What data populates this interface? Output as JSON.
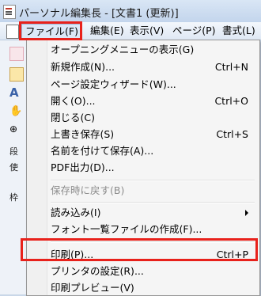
{
  "window": {
    "title": "パーソナル編集長 - [文書1 (更新)]"
  },
  "menubar": {
    "items": [
      {
        "label": "ファイル(F)"
      },
      {
        "label": "編集(E)"
      },
      {
        "label": "表示(V)"
      },
      {
        "label": "ページ(P)"
      },
      {
        "label": "書式(L)"
      }
    ]
  },
  "leftstrip": {
    "label1": "段",
    "label2": "使",
    "label3": "枠"
  },
  "file_menu": {
    "items": [
      {
        "label": "オープニングメニューの表示(G)",
        "shortcut": ""
      },
      {
        "label": "新規作成(N)...",
        "shortcut": "Ctrl+N"
      },
      {
        "label": "ページ設定ウィザード(W)...",
        "shortcut": ""
      },
      {
        "label": "開く(O)...",
        "shortcut": "Ctrl+O"
      },
      {
        "label": "閉じる(C)",
        "shortcut": ""
      },
      {
        "label": "上書き保存(S)",
        "shortcut": "Ctrl+S"
      },
      {
        "label": "名前を付けて保存(A)...",
        "shortcut": ""
      },
      {
        "label": "PDF出力(D)...",
        "shortcut": ""
      },
      {
        "label": "保存時に戻す(B)",
        "shortcut": ""
      },
      {
        "label": "読み込み(I)",
        "shortcut": ""
      },
      {
        "label": "フォント一覧ファイルの作成(F)...",
        "shortcut": ""
      },
      {
        "label": "印刷(P)...",
        "shortcut": "Ctrl+P"
      },
      {
        "label": "プリンタの設定(R)...",
        "shortcut": ""
      },
      {
        "label": "印刷プレビュー(V)",
        "shortcut": ""
      }
    ]
  },
  "colors": {
    "highlight": "#e8211b",
    "disabled_text": "#8d8d8d"
  }
}
